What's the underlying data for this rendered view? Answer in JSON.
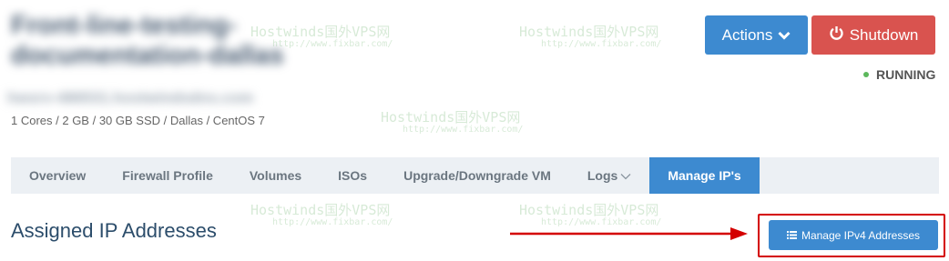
{
  "server": {
    "name": "Front-line-testing-documentation-dallas",
    "hostname": "hwsrv-486531.hostwindsdns.com",
    "specs": "1 Cores / 2 GB / 30 GB SSD / Dallas / CentOS 7",
    "status": "RUNNING"
  },
  "header": {
    "actions_label": "Actions",
    "shutdown_label": "Shutdown"
  },
  "tabs": [
    {
      "label": "Overview"
    },
    {
      "label": "Firewall Profile"
    },
    {
      "label": "Volumes"
    },
    {
      "label": "ISOs"
    },
    {
      "label": "Upgrade/Downgrade VM"
    },
    {
      "label": "Logs"
    },
    {
      "label": "Manage IP's"
    }
  ],
  "section": {
    "heading": "Assigned IP Addresses",
    "manage_ipv4_label": "Manage IPv4 Addresses"
  },
  "watermark": {
    "title": "Hostwinds国外VPS网",
    "url": "http://www.fixbar.com/"
  },
  "colors": {
    "primary": "#3d8ad0",
    "danger": "#d9534f",
    "status_running": "#5cb85c",
    "annotation_red": "#d40000"
  }
}
